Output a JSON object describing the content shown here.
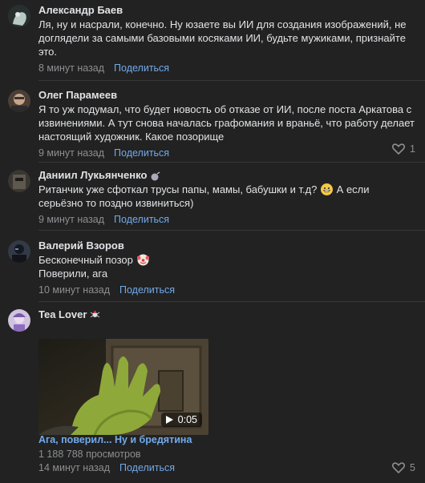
{
  "comments": [
    {
      "author": "Александр Баев",
      "lines": [
        "Ля, ну и насрали, конечно. Ну юзаете вы ИИ для создания изображений, не",
        "доглядели за самыми базовыми косяками ИИ, будьте мужиками, признайте",
        "это."
      ],
      "time": "8 минут назад",
      "share": "Поделиться"
    },
    {
      "author": "Олег Парамеев",
      "lines": [
        "Я то уж подумал, что будет новость об отказе от ИИ, после поста Аркатова с",
        "извинениями. А тут снова началась графомания и враньё, что работу делает",
        "настоящий художник. Какое позорище"
      ],
      "time": "9 минут назад",
      "share": "Поделиться",
      "likes": "1"
    },
    {
      "author": "Даниил Лукьянченко",
      "line1": "Ританчик уже сфоткал трусы папы, мамы, бабушки и т.д?",
      "line1b": "А если",
      "line2": "серьёзно то поздно извиниться)",
      "time": "9 минут назад",
      "share": "Поделиться"
    },
    {
      "author": "Валерий Взоров",
      "line1": "Бесконечный позор",
      "line2": "Поверили, ага",
      "time": "10 минут назад",
      "share": "Поделиться"
    },
    {
      "author": "Tea Lover",
      "video_duration": "0:05",
      "video_title": "Ага, поверил... Ну и бредятина",
      "video_views": "1 188 788 просмотров",
      "time": "14 минут назад",
      "share": "Поделиться",
      "likes": "5"
    }
  ],
  "colors": {
    "background": "#222222",
    "text": "#e1e3e6",
    "muted": "#8c8e91",
    "link": "#71aaeb"
  },
  "icons": [
    "heart-icon",
    "play-icon",
    "grinning-emoji",
    "clown-emoji",
    "bomb-badge",
    "spider-badge"
  ]
}
